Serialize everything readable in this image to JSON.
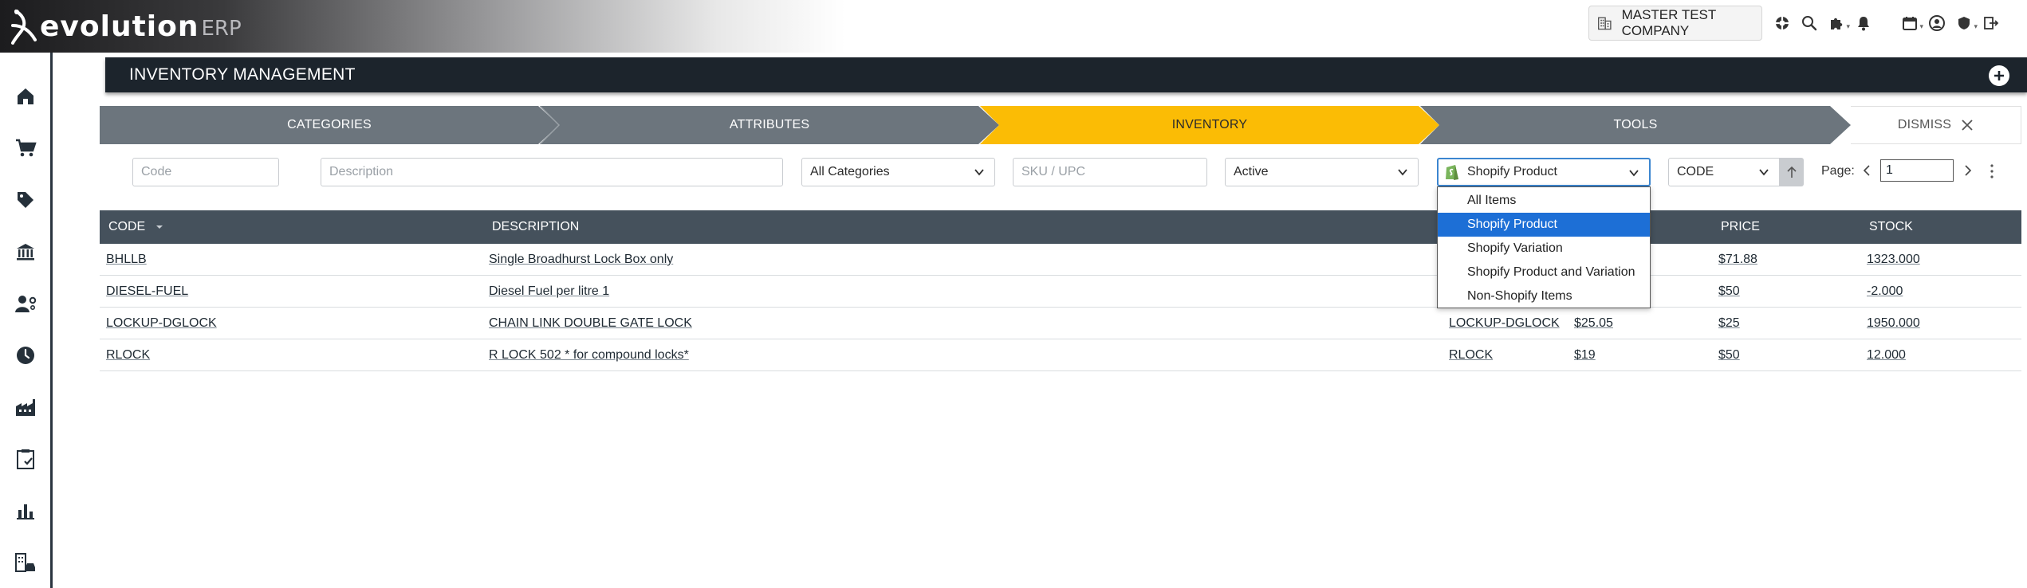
{
  "app": {
    "logo_text": "evolution",
    "logo_suffix": "ERP"
  },
  "header": {
    "company": "MASTER TEST COMPANY"
  },
  "page": {
    "title": "INVENTORY MANAGEMENT"
  },
  "steps": [
    {
      "label": "CATEGORIES",
      "color": "#6c757d"
    },
    {
      "label": "ATTRIBUTES",
      "color": "#6c757d"
    },
    {
      "label": "INVENTORY",
      "color": "#fbbc05"
    },
    {
      "label": "TOOLS",
      "color": "#6c757d"
    },
    {
      "label": "DISMISS"
    }
  ],
  "filters": {
    "code_placeholder": "Code",
    "description_placeholder": "Description",
    "category_value": "All Categories",
    "sku_placeholder": "SKU / UPC",
    "status_value": "Active",
    "shopify_value": "Shopify Product",
    "sort_value": "CODE",
    "page_label": "Page:",
    "page_value": "1"
  },
  "dropdown": {
    "options": [
      "All Items",
      "Shopify Product",
      "Shopify Variation",
      "Shopify Product and Variation",
      "Non-Shopify Items"
    ],
    "selected_index": 1
  },
  "table": {
    "headers": {
      "code": "CODE",
      "description": "DESCRIPTION",
      "price": "PRICE",
      "stock": "STOCK"
    },
    "rows": [
      {
        "code": "BHLLB",
        "description": "Single Broadhurst Lock Box only",
        "sku": "",
        "cost": "",
        "price": "$71.88",
        "stock": "1323.000"
      },
      {
        "code": "DIESEL-FUEL",
        "description": "Diesel Fuel per litre 1",
        "sku": "",
        "cost": "",
        "price": "$50",
        "stock": "-2.000"
      },
      {
        "code": "LOCKUP-DGLOCK",
        "description": "CHAIN LINK DOUBLE GATE LOCK",
        "sku": "LOCKUP-DGLOCK",
        "cost": "$25.05",
        "price": "$25",
        "stock": "1950.000"
      },
      {
        "code": "RLOCK",
        "description": "R LOCK 502 * for compound locks*",
        "sku": "RLOCK",
        "cost": "$19",
        "price": "$50",
        "stock": "12.000"
      }
    ]
  }
}
